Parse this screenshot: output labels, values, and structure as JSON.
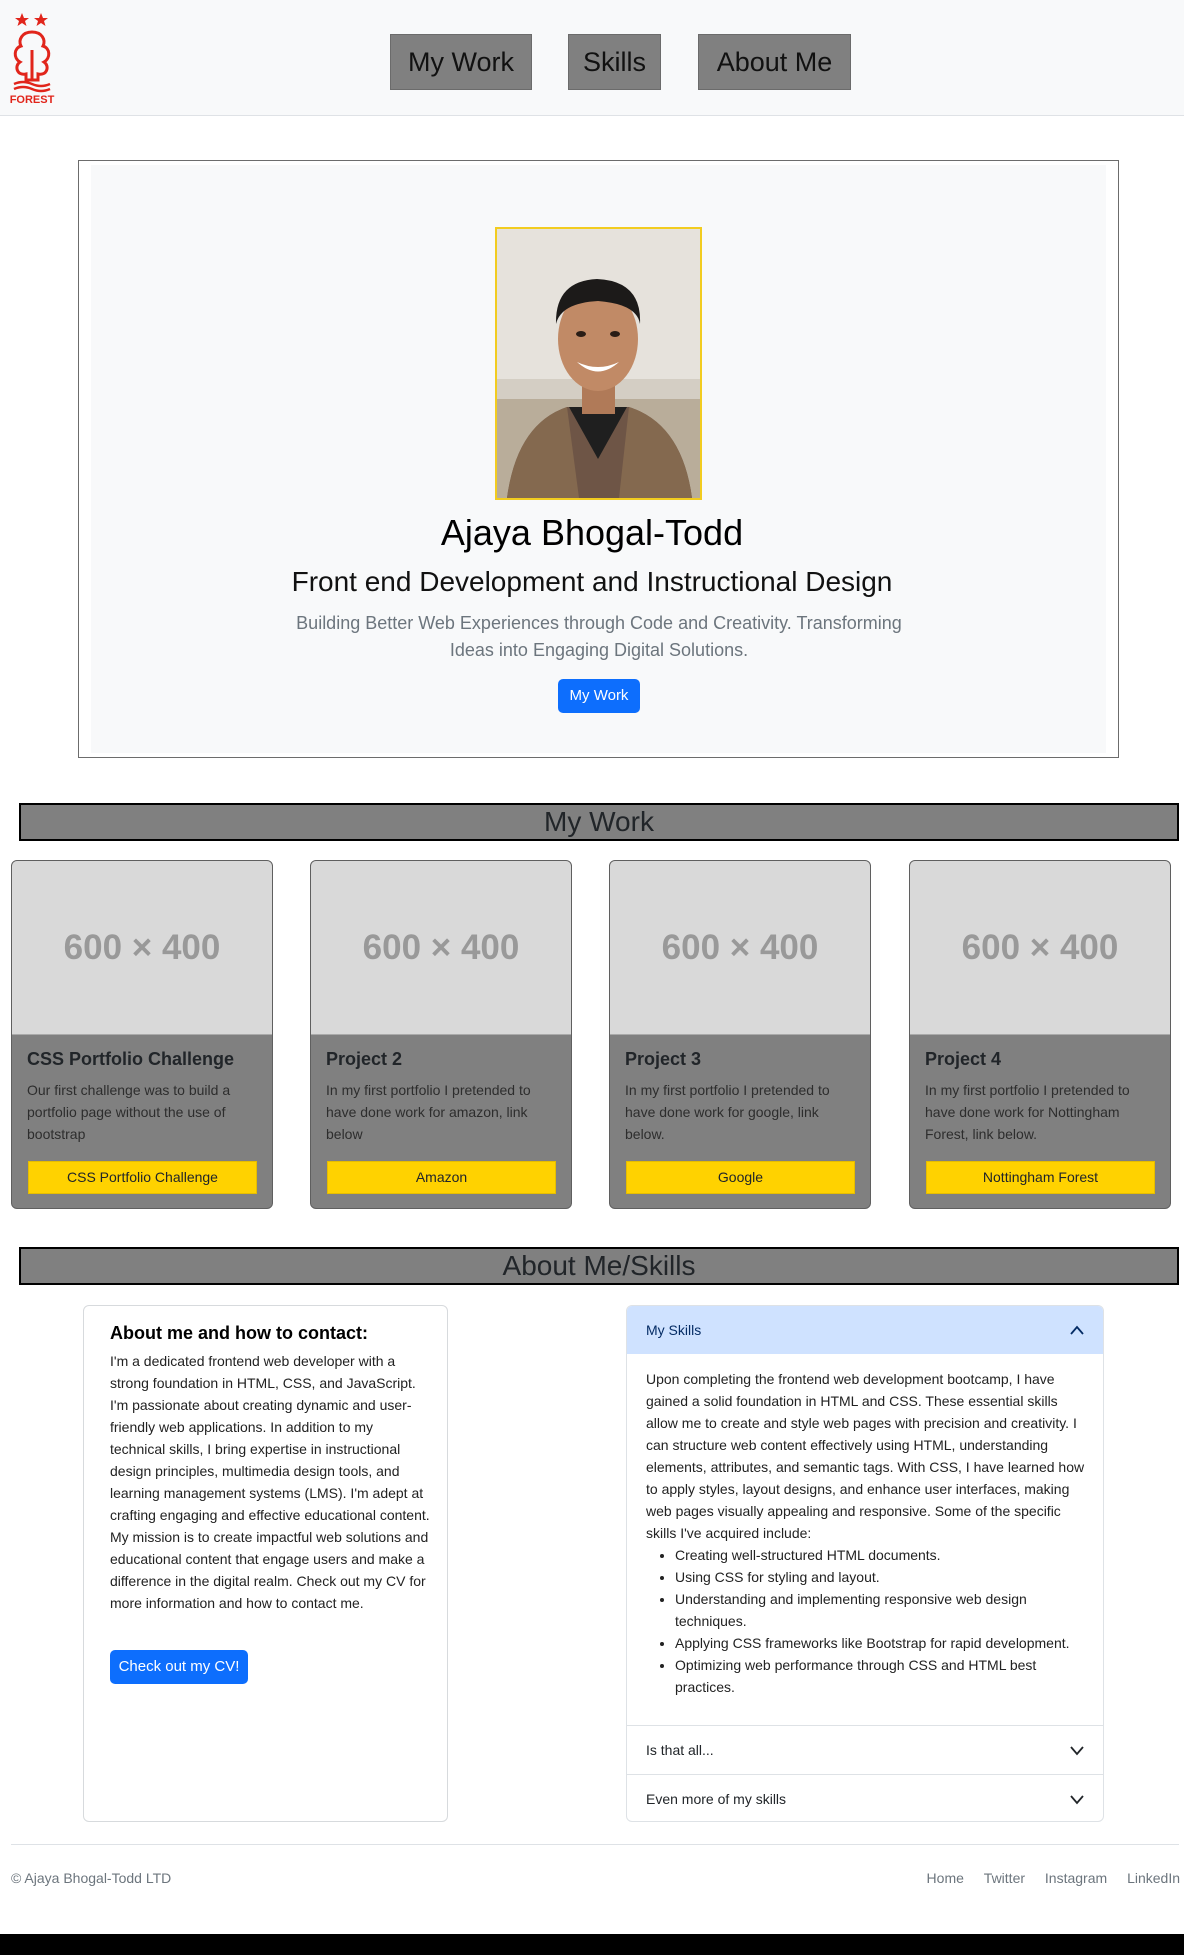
{
  "nav": {
    "items": [
      "My Work",
      "Skills",
      "About Me"
    ]
  },
  "logo": {
    "text": "FOREST",
    "color": "#e1251b"
  },
  "hero": {
    "name": "Ajaya Bhogal-Todd",
    "subtitle": "Front end Development and Instructional Design",
    "lead": "Building Better Web Experiences through Code and Creativity. Transforming Ideas into Engaging Digital Solutions.",
    "button": "My Work"
  },
  "work": {
    "heading": "My Work",
    "cards": [
      {
        "image_text": "600 × 400",
        "title": "CSS Portfolio Challenge",
        "text": "Our first challenge was to build a portfolio page without the use of bootstrap",
        "button": "CSS Portfolio Challenge"
      },
      {
        "image_text": "600 × 400",
        "title": "Project 2",
        "text": "In my first portfolio I pretended to have done work for amazon, link below",
        "button": "Amazon"
      },
      {
        "image_text": "600 × 400",
        "title": "Project 3",
        "text": "In my first portfolio I pretended to have done work for google, link below.",
        "button": "Google"
      },
      {
        "image_text": "600 × 400",
        "title": "Project 4",
        "text": "In my first portfolio I pretended to have done work for Nottingham Forest, link below.",
        "button": "Nottingham Forest"
      }
    ]
  },
  "about": {
    "heading": "About Me/Skills",
    "card_title": "About me and how to contact:",
    "card_text": "I'm a dedicated frontend web developer with a strong foundation in HTML, CSS, and JavaScript. I'm passionate about creating dynamic and user-friendly web applications. In addition to my technical skills, I bring expertise in instructional design principles, multimedia design tools, and learning management systems (LMS). I'm adept at crafting engaging and effective educational content. My mission is to create impactful web solutions and educational content that engage users and make a difference in the digital realm. Check out my CV for more information and how to contact me.",
    "cv_button": "Check out my CV!"
  },
  "accordion": {
    "items": [
      {
        "title": "My Skills",
        "expanded": true,
        "body": "Upon completing the frontend web development bootcamp, I have gained a solid foundation in HTML and CSS. These essential skills allow me to create and style web pages with precision and creativity. I can structure web content effectively using HTML, understanding elements, attributes, and semantic tags. With CSS, I have learned how to apply styles, layout designs, and enhance user interfaces, making web pages visually appealing and responsive. Some of the specific skills I've acquired include:",
        "list": [
          "Creating well-structured HTML documents.",
          "Using CSS for styling and layout.",
          "Understanding and implementing responsive web design techniques.",
          "Applying CSS frameworks like Bootstrap for rapid development.",
          "Optimizing web performance through CSS and HTML best practices."
        ]
      },
      {
        "title": "Is that all...",
        "expanded": false
      },
      {
        "title": "Even more of my skills",
        "expanded": false
      }
    ]
  },
  "footer": {
    "copyright": "© Ajaya Bhogal-Todd LTD",
    "links": [
      "Home",
      "Twitter",
      "Instagram",
      "LinkedIn"
    ]
  },
  "colors": {
    "nav_button": "#808080",
    "accent_yellow": "#ffd200",
    "primary_blue": "#0d6efd",
    "accordion_open": "#cfe2ff",
    "avatar_border": "#f2cc1f"
  }
}
